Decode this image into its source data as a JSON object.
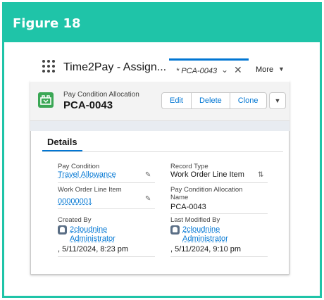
{
  "figure": {
    "title": "Figure 18"
  },
  "topbar": {
    "app_name": "Time2Pay - Assign...",
    "active_tab": {
      "label": "* PCA-0043",
      "chevron": "chevron-down-icon",
      "close": "close-icon"
    },
    "more_label": "More"
  },
  "record": {
    "object_label": "Pay Condition Allocation",
    "name": "PCA-0043",
    "buttons": {
      "edit": "Edit",
      "delete": "Delete",
      "clone": "Clone"
    }
  },
  "details": {
    "tab_label": "Details",
    "fields": {
      "pay_condition": {
        "label": "Pay Condition",
        "value": "Travel Allowance"
      },
      "record_type": {
        "label": "Record Type",
        "value": "Work Order Line Item"
      },
      "work_order_line_item": {
        "label": "Work Order Line Item",
        "value": "00000001"
      },
      "allocation_name": {
        "label_1": "Pay Condition Allocation",
        "label_2": "Name",
        "value": "PCA-0043"
      },
      "created_by": {
        "label": "Created By",
        "user_1": "2cloudnine",
        "user_2": "Administrator",
        "date": ", 5/11/2024, 8:23 pm"
      },
      "last_modified_by": {
        "label": "Last Modified By",
        "user_1": "2cloudnine",
        "user_2": "Administrator",
        "date": ", 5/11/2024, 9:10 pm"
      }
    }
  },
  "colors": {
    "accent": "#1fc4a8",
    "brand_blue": "#0176d3",
    "record_icon": "#3ba755"
  }
}
